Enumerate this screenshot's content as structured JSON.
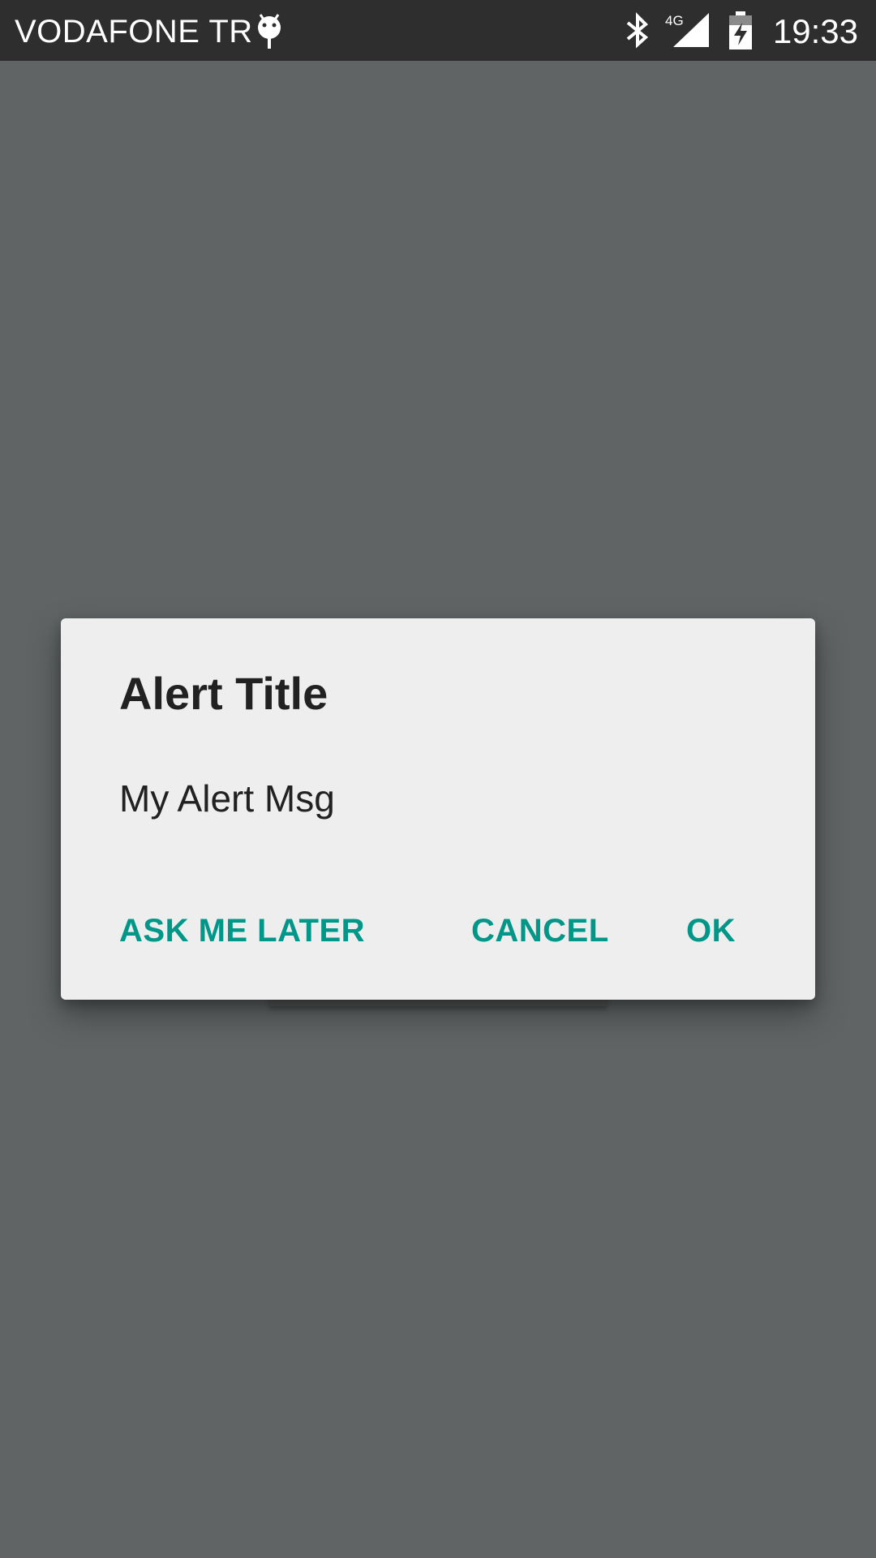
{
  "status_bar": {
    "carrier": "VODAFONE TR",
    "network_type": "4G",
    "time": "19:33",
    "icons": [
      "android-debug-icon",
      "bluetooth-icon",
      "signal-4g-icon",
      "battery-charging-icon"
    ]
  },
  "dialog": {
    "title": "Alert Title",
    "message": "My Alert Msg",
    "buttons": {
      "neutral": "ASK ME LATER",
      "negative": "CANCEL",
      "positive": "OK"
    }
  },
  "colors": {
    "accent": "#009688",
    "scrim": "#606465",
    "dialog_bg": "#eeeeee",
    "status_bar": "#2e2e2e",
    "text": "#212121"
  }
}
